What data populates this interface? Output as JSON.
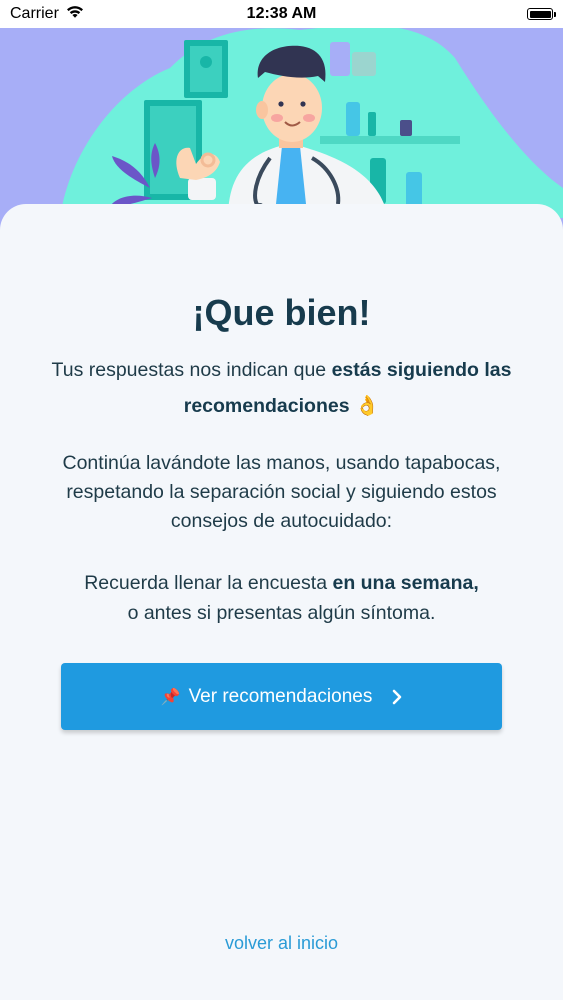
{
  "status_bar": {
    "carrier": "Carrier",
    "time": "12:38 AM"
  },
  "result": {
    "title": "¡Que bien!",
    "intro_plain": "Tus respuestas nos indican que ",
    "intro_bold": "estás siguiendo las recomendaciones",
    "intro_emoji": "👌",
    "advice": "Continúa lavándote las manos, usando tapabocas, respetando la separación social y siguiendo estos consejos de autocuidado:",
    "reminder_plain_1": "Recuerda llenar la encuesta ",
    "reminder_bold": "en una semana,",
    "reminder_plain_2": "o antes si presentas algún síntoma."
  },
  "actions": {
    "primary_icon": "📌",
    "primary_label": "Ver recomendaciones",
    "back_label": "volver al inicio"
  },
  "colors": {
    "accent": "#1f9ae0",
    "title": "#173b4d",
    "link": "#2a9bd6",
    "hero_bg": "#a7aef7",
    "hero_blob": "#6ff0dc"
  },
  "icons": [
    "wifi-icon",
    "battery-icon",
    "pin-icon",
    "chevron-right-icon",
    "doctor-illustration"
  ]
}
